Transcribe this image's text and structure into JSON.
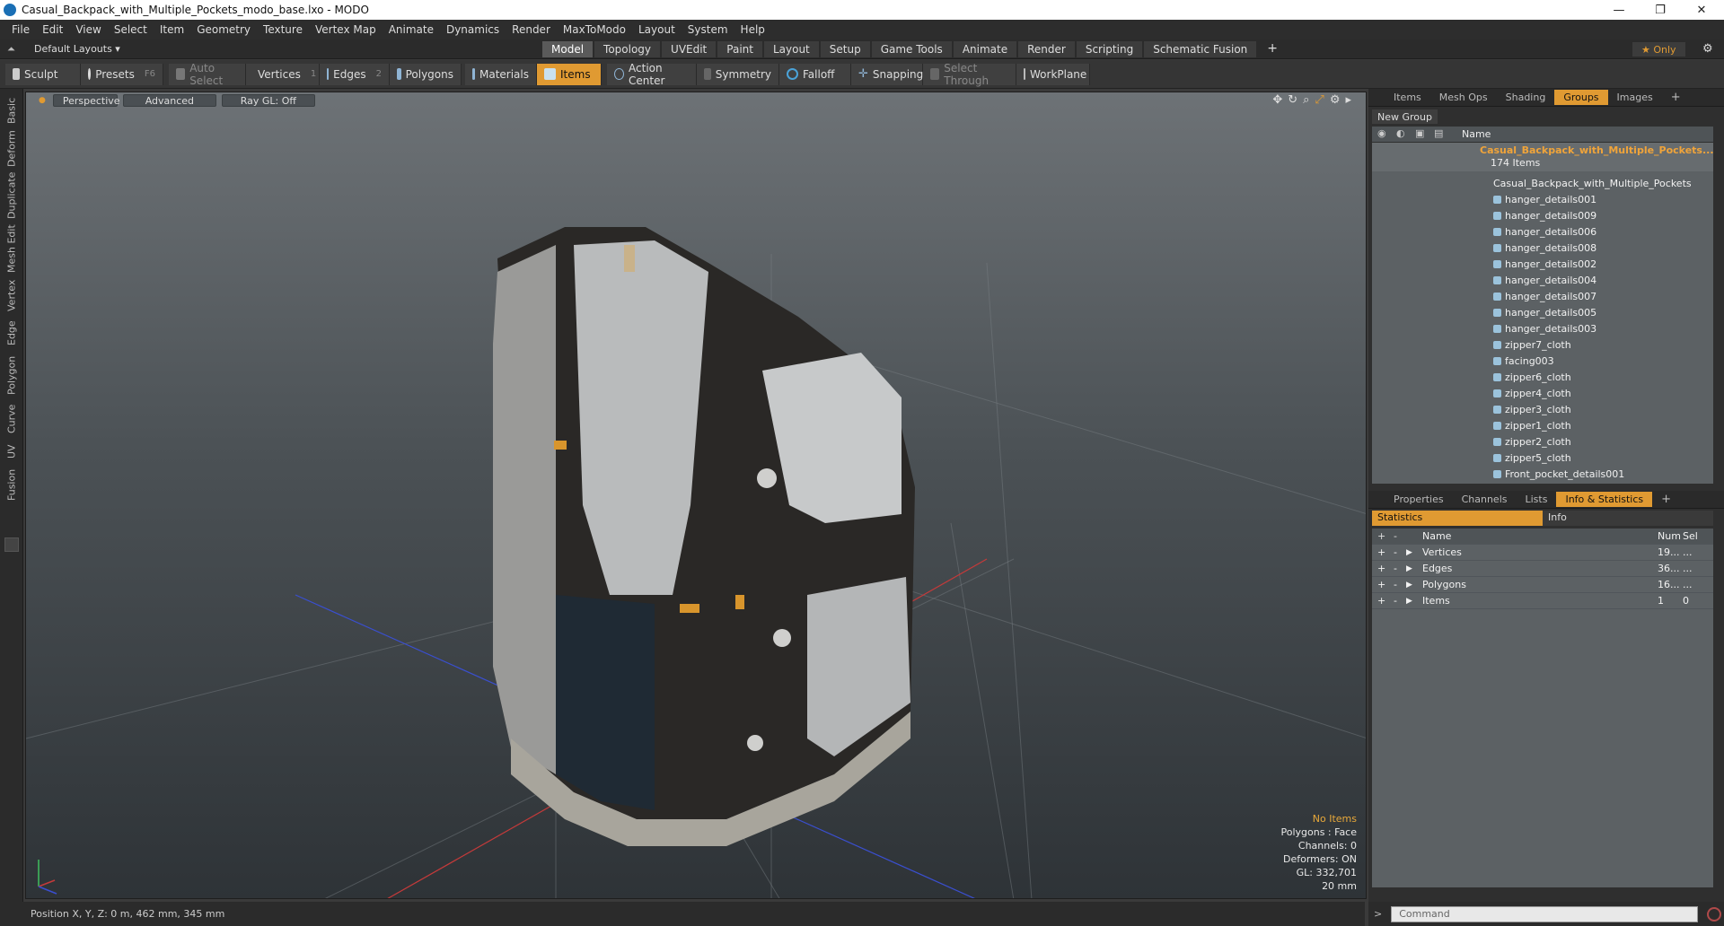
{
  "window": {
    "title": "Casual_Backpack_with_Multiple_Pockets_modo_base.lxo - MODO",
    "minimize": "—",
    "maximize": "❐",
    "close": "✕"
  },
  "menu": [
    "File",
    "Edit",
    "View",
    "Select",
    "Item",
    "Geometry",
    "Texture",
    "Vertex Map",
    "Animate",
    "Dynamics",
    "Render",
    "MaxToModo",
    "Layout",
    "System",
    "Help"
  ],
  "layoutbar": {
    "layouts_label": "Default Layouts ▾",
    "tabs": [
      "Model",
      "Topology",
      "UVEdit",
      "Paint",
      "Layout",
      "Setup",
      "Game Tools",
      "Animate",
      "Render",
      "Scripting",
      "Schematic Fusion"
    ],
    "active_tab": "Model",
    "add": "+",
    "only": "★ Only"
  },
  "toolbar": {
    "sculpt": "Sculpt",
    "presets": "Presets",
    "presets_key": "F6",
    "auto_select": "Auto Select",
    "vertices": "Vertices",
    "vertices_count": "1",
    "edges": "Edges",
    "edges_count": "2",
    "polygons": "Polygons",
    "materials": "Materials",
    "items": "Items",
    "action_center": "Action Center",
    "symmetry": "Symmetry",
    "falloff": "Falloff",
    "snapping": "Snapping",
    "select_through": "Select Through",
    "workplane": "WorkPlane"
  },
  "left_tabs": [
    "Basic",
    "Deform",
    "Duplicate",
    "Mesh Edit",
    "Vertex",
    "Edge",
    "Polygon",
    "Curve",
    "UV",
    "Fusion"
  ],
  "viewport": {
    "view": "Perspective",
    "shading": "Advanced",
    "raygl": "Ray GL: Off",
    "info": {
      "selection": "No Items",
      "polygons": "Polygons : Face",
      "channels": "Channels: 0",
      "deformers": "Deformers: ON",
      "gl": "GL: 332,701",
      "scale": "20 mm"
    }
  },
  "top_panel": {
    "tabs": [
      "Items",
      "Mesh Ops",
      "Shading",
      "Groups",
      "Images"
    ],
    "active_tab": "Groups",
    "new_group": "New Group",
    "column_name": "Name",
    "group_name": "Casual_Backpack_with_Multiple_Pockets...",
    "group_count": "174 Items",
    "items": [
      "Casual_Backpack_with_Multiple_Pockets",
      "hanger_details001",
      "hanger_details009",
      "hanger_details006",
      "hanger_details008",
      "hanger_details002",
      "hanger_details004",
      "hanger_details007",
      "hanger_details005",
      "hanger_details003",
      "zipper7_cloth",
      "facing003",
      "zipper6_cloth",
      "zipper4_cloth",
      "zipper3_cloth",
      "zipper1_cloth",
      "zipper2_cloth",
      "zipper5_cloth",
      "Front_pocket_details001"
    ]
  },
  "bottom_panel": {
    "tabs": [
      "Properties",
      "Channels",
      "Lists",
      "Info & Statistics"
    ],
    "active_tab": "Info & Statistics",
    "sub_tabs": [
      "Statistics",
      "Info"
    ],
    "columns": {
      "name": "Name",
      "num": "Num",
      "sel": "Sel"
    },
    "rows": [
      {
        "name": "Vertices",
        "num": "19...",
        "sel": "..."
      },
      {
        "name": "Edges",
        "num": "36...",
        "sel": "..."
      },
      {
        "name": "Polygons",
        "num": "16...",
        "sel": "..."
      },
      {
        "name": "Items",
        "num": "1",
        "sel": "0"
      }
    ]
  },
  "status": {
    "position": "Position X, Y, Z:  0 m, 462 mm, 345 mm",
    "command_placeholder": "Command"
  },
  "colors": {
    "accent": "#e09a32",
    "panel_bg": "#5c6164"
  }
}
